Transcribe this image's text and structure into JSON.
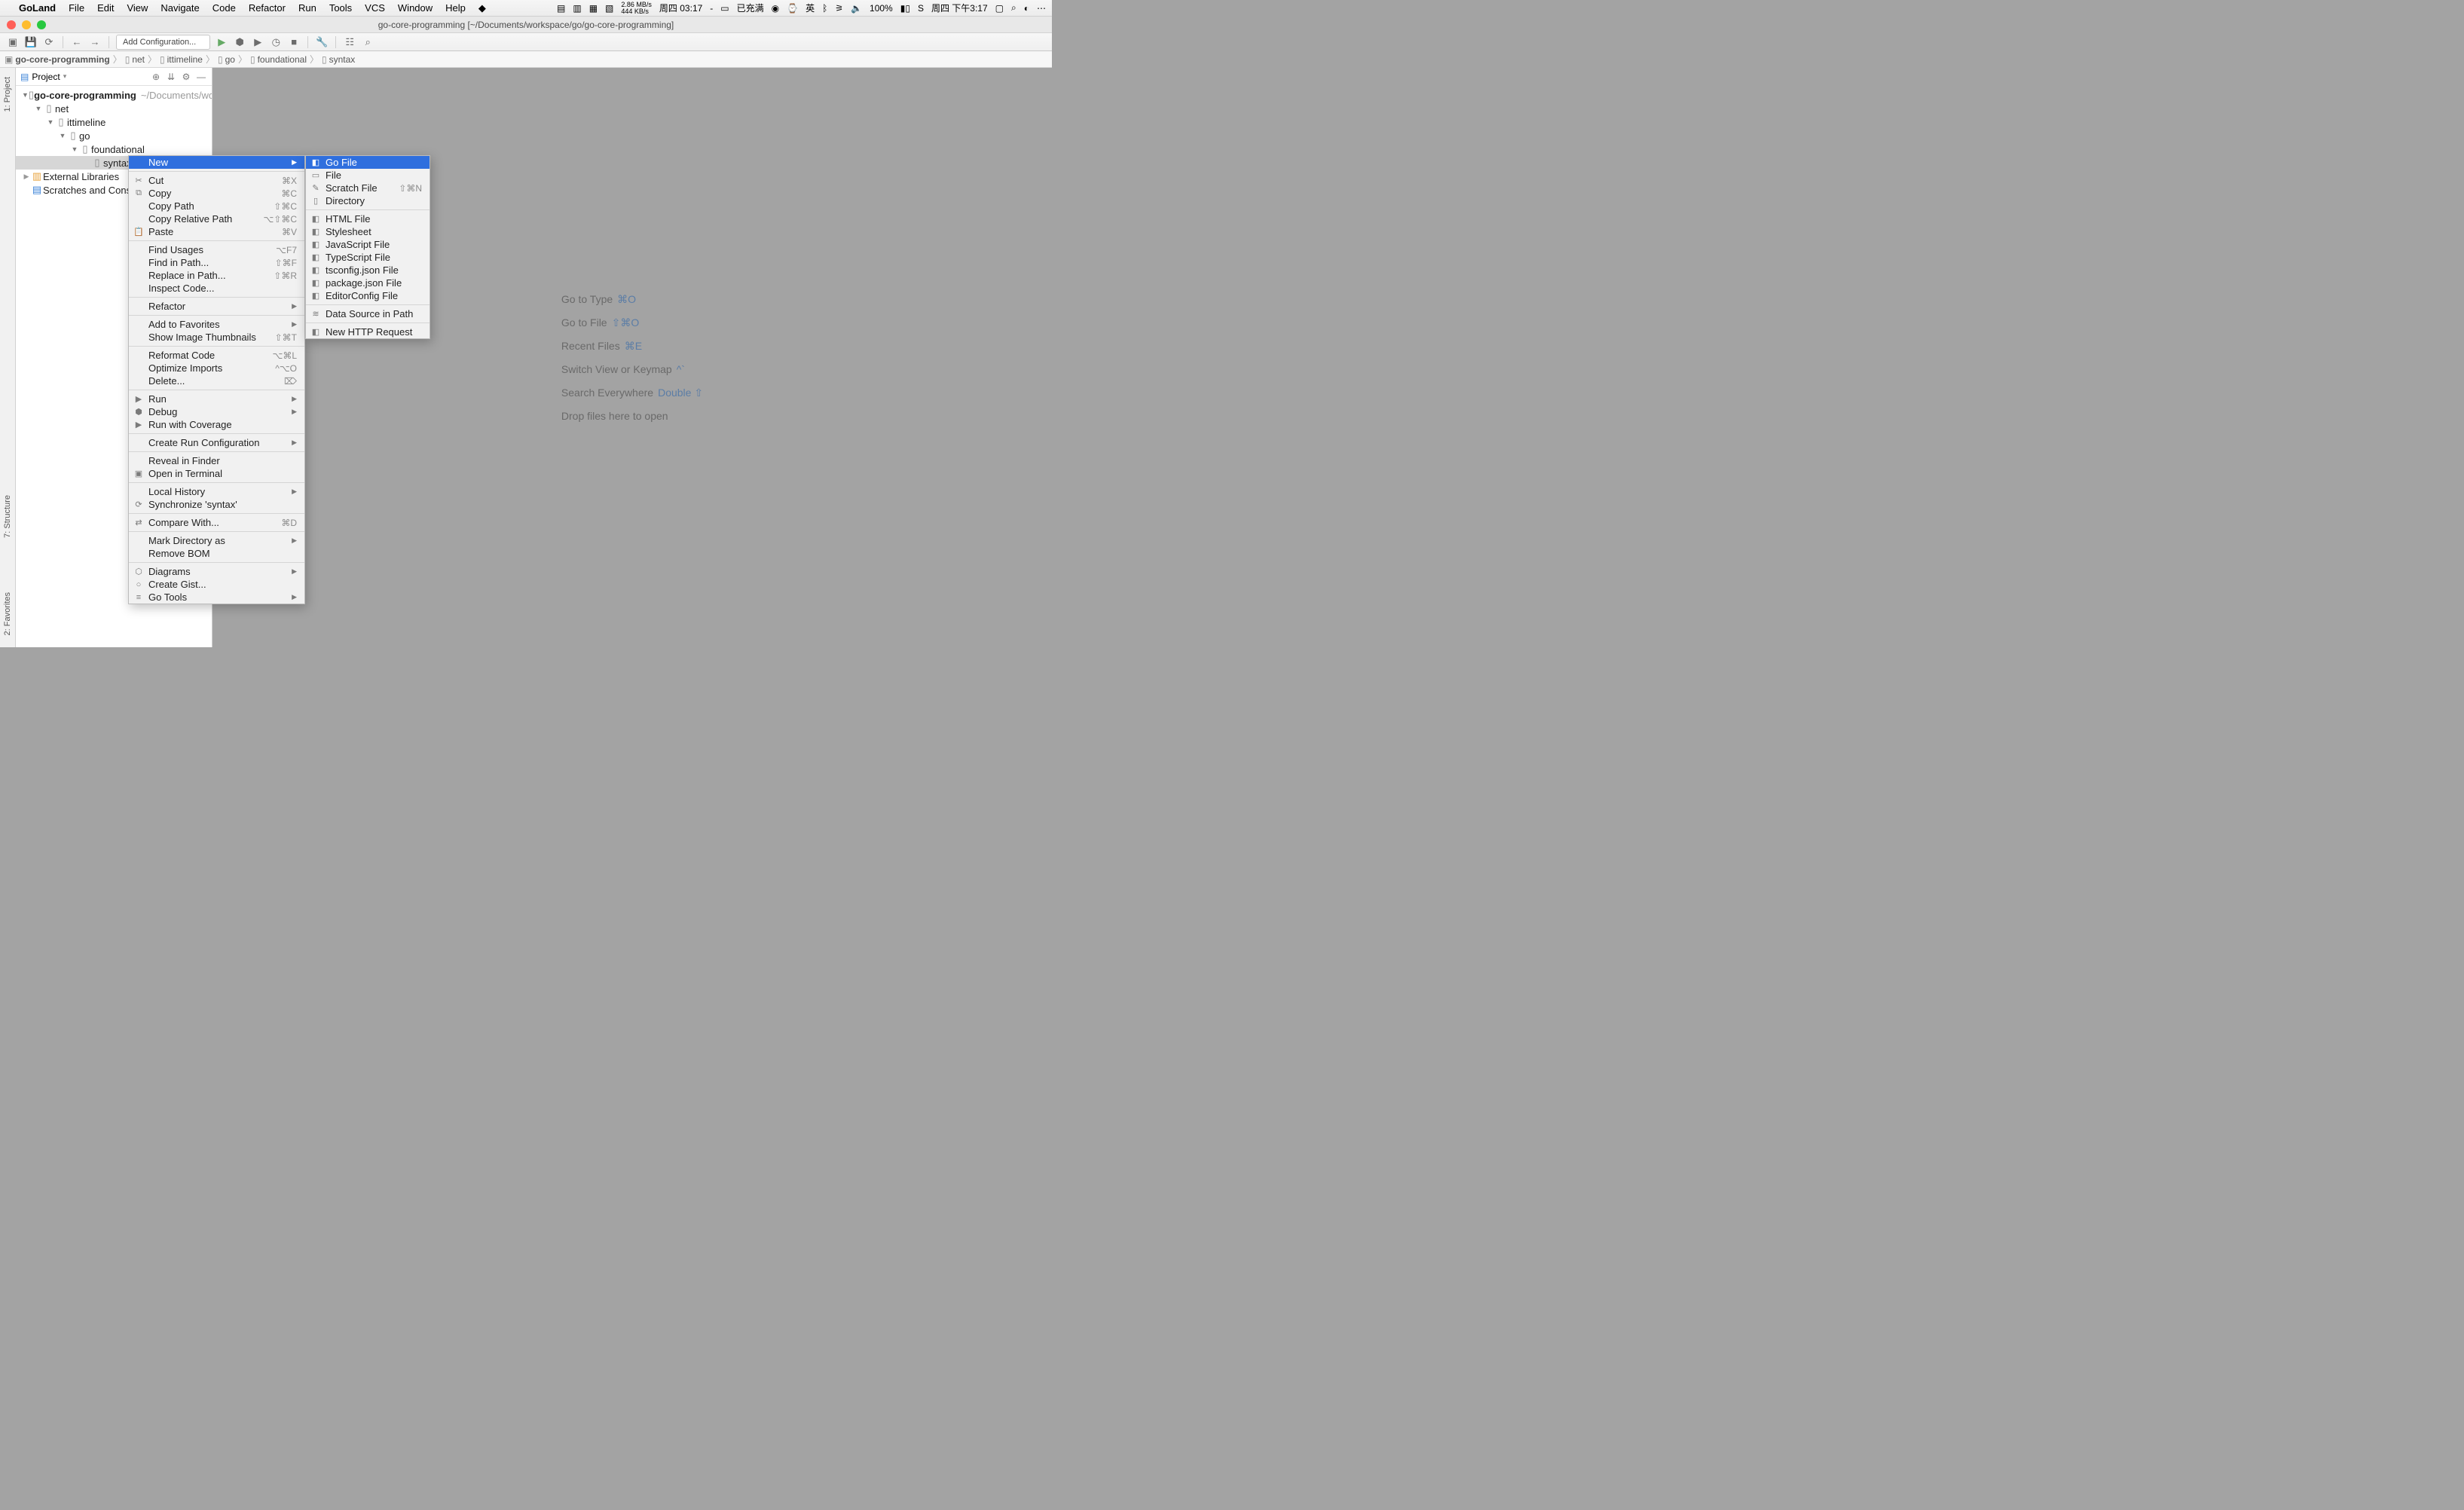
{
  "menubar": {
    "app": "GoLand",
    "items": [
      "File",
      "Edit",
      "View",
      "Navigate",
      "Code",
      "Refactor",
      "Run",
      "Tools",
      "VCS",
      "Window",
      "Help"
    ],
    "right": {
      "net_up": "2.86 MB/s",
      "net_down": "444 KB/s",
      "time_cn1": "周四 03:17",
      "battery_label": "已充满",
      "battery_pct": "100%",
      "time_cn2": "周四 下午3:17"
    }
  },
  "titlebar": {
    "title": "go-core-programming [~/Documents/workspace/go/go-core-programming]"
  },
  "toolbar": {
    "add_config": "Add Configuration..."
  },
  "breadcrumbs": [
    "go-core-programming",
    "net",
    "ittimeline",
    "go",
    "foundational",
    "syntax"
  ],
  "sidebar": {
    "title": "Project",
    "tree": {
      "project": "go-core-programming",
      "project_hint": "~/Documents/work",
      "net": "net",
      "ittimeline": "ittimeline",
      "go": "go",
      "foundational": "foundational",
      "syntax": "syntax",
      "ext": "External Libraries",
      "scratch": "Scratches and Console"
    }
  },
  "gutter": {
    "project": "1: Project",
    "structure": "7: Structure",
    "favorites": "2: Favorites"
  },
  "welcome": {
    "rows": [
      {
        "label": "Go to Type",
        "kb": "⌘O"
      },
      {
        "label": "Go to File",
        "kb": "⇧⌘O"
      },
      {
        "label": "Recent Files",
        "kb": "⌘E"
      },
      {
        "label": "Switch View or Keymap",
        "kb": "^`"
      },
      {
        "label": "Search Everywhere",
        "kb": "Double ⇧"
      },
      {
        "label": "Drop files here to open",
        "kb": ""
      }
    ]
  },
  "ctx_main": [
    {
      "t": "item",
      "label": "New",
      "sub": true,
      "hover": true
    },
    {
      "t": "div"
    },
    {
      "t": "item",
      "icon": "✂",
      "label": "Cut",
      "sc": "⌘X"
    },
    {
      "t": "item",
      "icon": "⧉",
      "label": "Copy",
      "sc": "⌘C"
    },
    {
      "t": "item",
      "label": "Copy Path",
      "sc": "⇧⌘C"
    },
    {
      "t": "item",
      "label": "Copy Relative Path",
      "sc": "⌥⇧⌘C"
    },
    {
      "t": "item",
      "icon": "📋",
      "label": "Paste",
      "sc": "⌘V"
    },
    {
      "t": "div"
    },
    {
      "t": "item",
      "label": "Find Usages",
      "sc": "⌥F7"
    },
    {
      "t": "item",
      "label": "Find in Path...",
      "sc": "⇧⌘F"
    },
    {
      "t": "item",
      "label": "Replace in Path...",
      "sc": "⇧⌘R"
    },
    {
      "t": "item",
      "label": "Inspect Code..."
    },
    {
      "t": "div"
    },
    {
      "t": "item",
      "label": "Refactor",
      "sub": true
    },
    {
      "t": "div"
    },
    {
      "t": "item",
      "label": "Add to Favorites",
      "sub": true
    },
    {
      "t": "item",
      "label": "Show Image Thumbnails",
      "sc": "⇧⌘T"
    },
    {
      "t": "div"
    },
    {
      "t": "item",
      "label": "Reformat Code",
      "sc": "⌥⌘L"
    },
    {
      "t": "item",
      "label": "Optimize Imports",
      "sc": "^⌥O"
    },
    {
      "t": "item",
      "label": "Delete...",
      "sc": "⌦"
    },
    {
      "t": "div"
    },
    {
      "t": "item",
      "icon": "▶",
      "label": "Run",
      "sub": true
    },
    {
      "t": "item",
      "icon": "⬢",
      "label": "Debug",
      "sub": true
    },
    {
      "t": "item",
      "icon": "▶",
      "label": "Run with Coverage"
    },
    {
      "t": "div"
    },
    {
      "t": "item",
      "label": "Create Run Configuration",
      "sub": true
    },
    {
      "t": "div"
    },
    {
      "t": "item",
      "label": "Reveal in Finder"
    },
    {
      "t": "item",
      "icon": "▣",
      "label": "Open in Terminal"
    },
    {
      "t": "div"
    },
    {
      "t": "item",
      "label": "Local History",
      "sub": true
    },
    {
      "t": "item",
      "icon": "⟳",
      "label": "Synchronize 'syntax'"
    },
    {
      "t": "div"
    },
    {
      "t": "item",
      "icon": "⇄",
      "label": "Compare With...",
      "sc": "⌘D"
    },
    {
      "t": "div"
    },
    {
      "t": "item",
      "label": "Mark Directory as",
      "sub": true
    },
    {
      "t": "item",
      "label": "Remove BOM"
    },
    {
      "t": "div"
    },
    {
      "t": "item",
      "icon": "⬡",
      "label": "Diagrams",
      "sub": true
    },
    {
      "t": "item",
      "icon": "○",
      "label": "Create Gist..."
    },
    {
      "t": "item",
      "icon": "≡",
      "label": "Go Tools",
      "sub": true
    }
  ],
  "ctx_sub": [
    {
      "t": "item",
      "icon": "◧",
      "label": "Go File",
      "hover": true
    },
    {
      "t": "item",
      "icon": "▭",
      "label": "File"
    },
    {
      "t": "item",
      "icon": "✎",
      "label": "Scratch File",
      "sc": "⇧⌘N"
    },
    {
      "t": "item",
      "icon": "▯",
      "label": "Directory"
    },
    {
      "t": "div"
    },
    {
      "t": "item",
      "icon": "◧",
      "label": "HTML File"
    },
    {
      "t": "item",
      "icon": "◧",
      "label": "Stylesheet"
    },
    {
      "t": "item",
      "icon": "◧",
      "label": "JavaScript File"
    },
    {
      "t": "item",
      "icon": "◧",
      "label": "TypeScript File"
    },
    {
      "t": "item",
      "icon": "◧",
      "label": "tsconfig.json File"
    },
    {
      "t": "item",
      "icon": "◧",
      "label": "package.json File"
    },
    {
      "t": "item",
      "icon": "◧",
      "label": "EditorConfig File"
    },
    {
      "t": "div"
    },
    {
      "t": "item",
      "icon": "≋",
      "label": "Data Source in Path"
    },
    {
      "t": "div"
    },
    {
      "t": "item",
      "icon": "◧",
      "label": "New HTTP Request"
    }
  ]
}
